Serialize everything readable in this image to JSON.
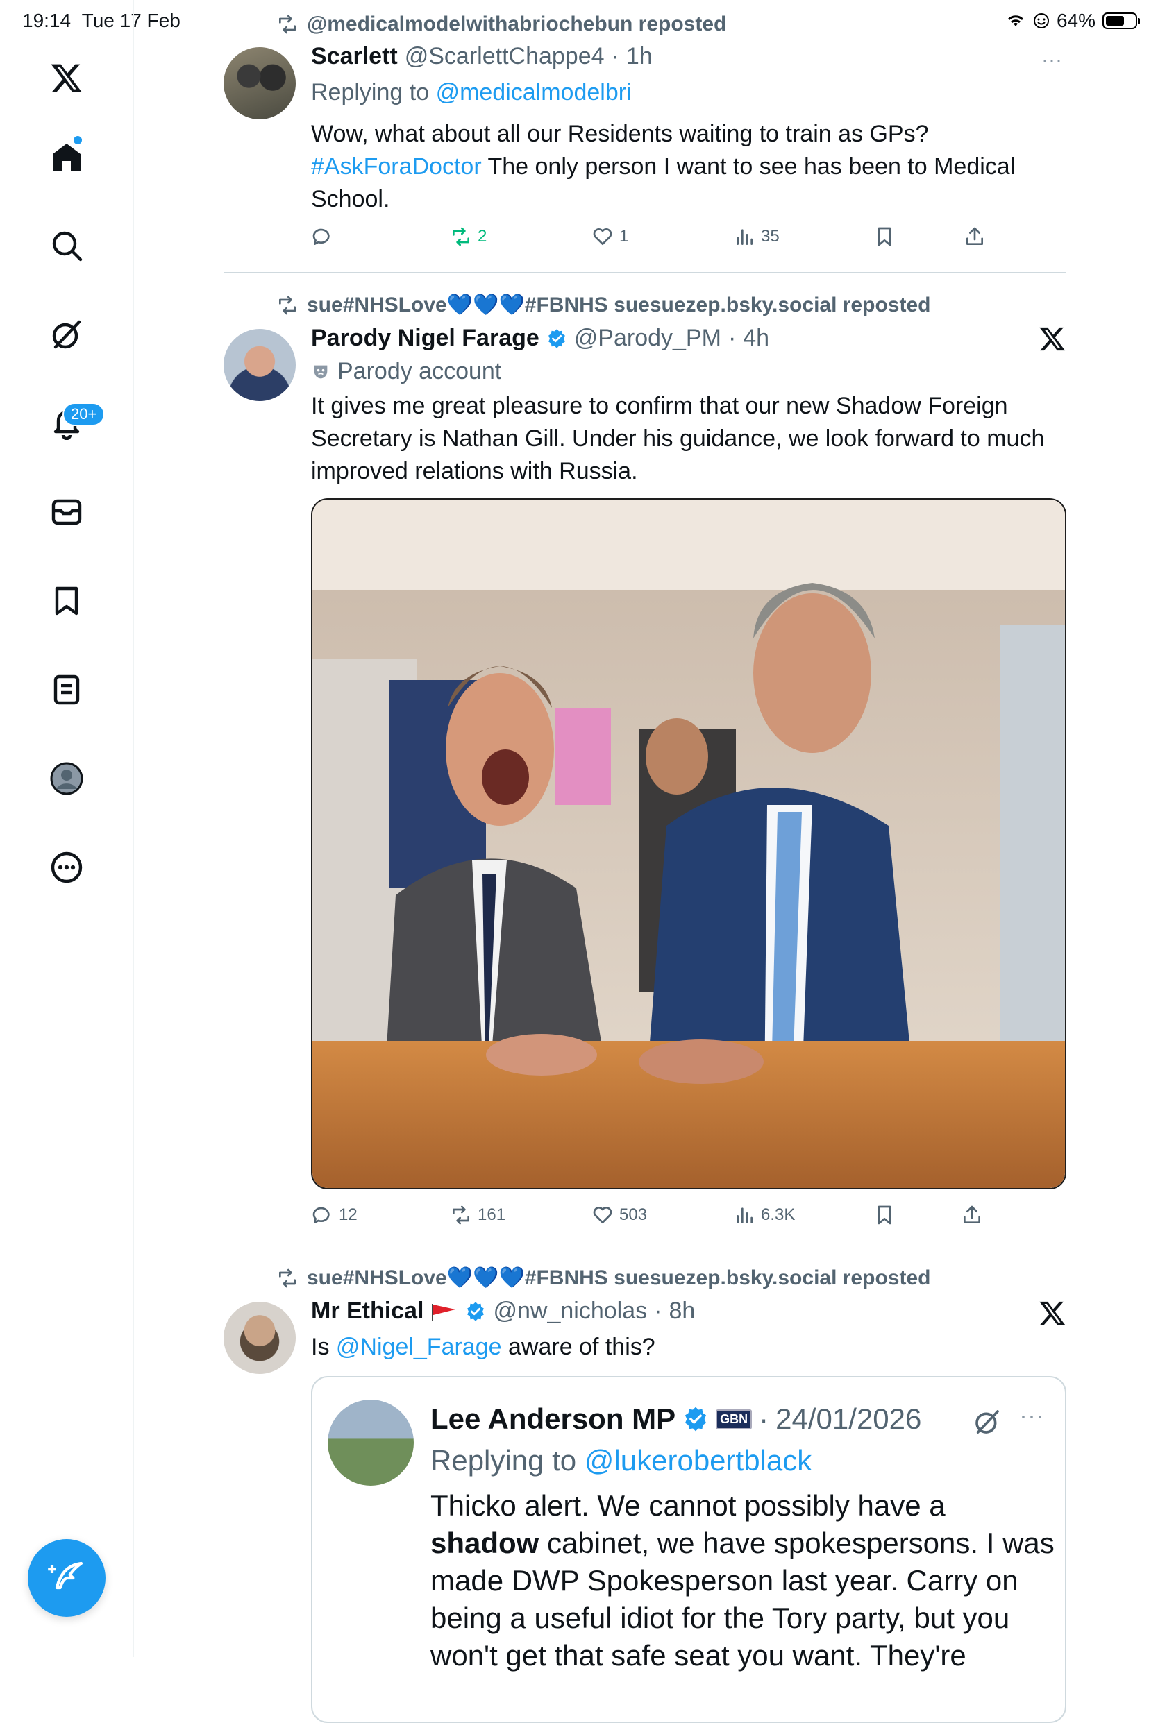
{
  "status_bar": {
    "time": "19:14",
    "date": "Tue 17 Feb",
    "battery": "64%",
    "battery_level": 0.64
  },
  "sidebar": {
    "items": [
      {
        "name": "x-logo-icon"
      },
      {
        "name": "home-icon"
      },
      {
        "name": "search-icon"
      },
      {
        "name": "grok-icon"
      },
      {
        "name": "notifications-icon"
      },
      {
        "name": "messages-icon"
      },
      {
        "name": "bookmarks-icon"
      },
      {
        "name": "lists-icon"
      },
      {
        "name": "profile-icon"
      },
      {
        "name": "more-icon"
      }
    ],
    "notifications_badge": "20+"
  },
  "posts": [
    {
      "repost_by": "@medicalmodelwithabriochebun reposted",
      "name": "Scarlett",
      "handle": "@ScarlettChappe4",
      "time": "1h",
      "replying_label": "Replying to",
      "replying_to": "@medicalmodelbri",
      "text_1": "Wow, what about all our Residents waiting to train as GPs?",
      "hashtag": "#AskForaDoctor",
      "text_2": " The only person I want to see has been to Medical School.",
      "replies": "",
      "reposts": "2",
      "likes": "1",
      "views": "35"
    },
    {
      "repost_by": "sue#NHSLove💙💙💙#FBNHS suesuezep.bsky.social reposted",
      "name": "Parody Nigel Farage",
      "handle": "@Parody_PM",
      "time": "4h",
      "parody_label": "Parody account",
      "text": "It gives me great pleasure to confirm that our new Shadow Foreign Secretary is Nathan Gill. Under his guidance, we look forward to much improved relations with Russia.",
      "replies": "12",
      "reposts": "161",
      "likes": "503",
      "views": "6.3K"
    },
    {
      "repost_by": "sue#NHSLove💙💙💙#FBNHS suesuezep.bsky.social reposted",
      "name": "Mr Ethical",
      "handle": "@nw_nicholas",
      "time": "8h",
      "text_1": "Is ",
      "mention": "@Nigel_Farage",
      "text_2": " aware of this?"
    }
  ],
  "quote": {
    "name": "Lee Anderson MP",
    "affiliation_badge": "GBN",
    "date": "24/01/2026",
    "replying_label": "Replying to",
    "replying_to": "@lukerobertblack",
    "text_1": "Thicko alert. We cannot possibly have a ",
    "bold_word": "shadow",
    "text_2": " cabinet, we have spokespersons. I was made DWP Spokesperson last year. Carry on being a useful idiot for the Tory party, but you won't get that safe seat you want. They're"
  },
  "colors": {
    "accent": "#1d9bf0",
    "repost_green": "#00ba7c",
    "muted": "#536471"
  }
}
